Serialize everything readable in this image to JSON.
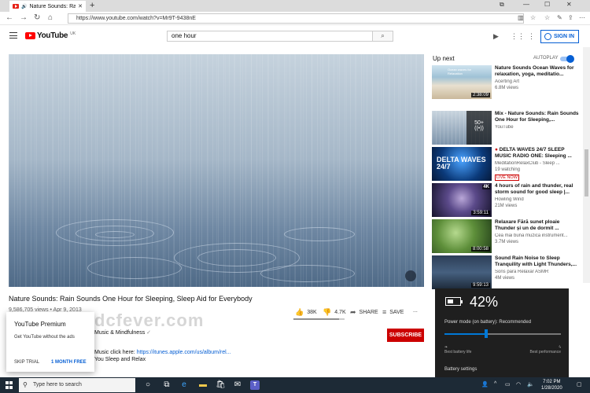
{
  "browser": {
    "tab_title": "Nature Sounds: Rai",
    "url": "https://www.youtube.com/watch?v=Mr9T-9438nE"
  },
  "youtube": {
    "logo_text": "YouTube",
    "region": "UK",
    "search_value": "one hour",
    "sign_in": "SIGN IN"
  },
  "video": {
    "title": "Nature Sounds: Rain Sounds One Hour for Sleeping, Sleep Aid for Everybody",
    "meta": "9,586,705 views • Apr 9, 2013",
    "likes": "38K",
    "dislikes": "4.7K",
    "like_ratio": 0.89,
    "share": "SHARE",
    "save": "SAVE",
    "more": "...",
    "channel": "Music & Mindfulness",
    "subscribe": "SUBSCRIBE",
    "desc_prefix": "Music click here: ",
    "desc_link": "https://itunes.apple.com/us/album/rel...",
    "desc_line2": "You Sleep and Relax"
  },
  "watermark": "dcfever.com",
  "premium": {
    "title": "YouTube Premium",
    "subtitle": "Get YouTube without the ads",
    "skip": "SKIP TRIAL",
    "free": "1 MONTH FREE"
  },
  "sidebar": {
    "up_next": "Up next",
    "autoplay": "AUTOPLAY",
    "items": [
      {
        "title": "Nature Sounds Ocean Waves for relaxation, yoga, meditatio...",
        "channel": "Acerting Art",
        "views": "6.8M views",
        "duration": "2:38:09",
        "thumb_text": "Ocean waves for Relaxation"
      },
      {
        "title": "Mix - Nature Sounds: Rain Sounds One Hour for Sleeping,...",
        "channel": "YouTube",
        "views": "",
        "duration": "",
        "mix_count": "50+"
      },
      {
        "title": "DELTA WAVES 24/7 SLEEP MUSIC RADIO ONE: Sleeping ...",
        "channel": "MeditationRelaxClub - Sleep ...",
        "views": "19 watching",
        "duration": "",
        "live": "LIVE NOW",
        "thumb_text": "DELTA WAVES 24/7"
      },
      {
        "title": "4 hours of rain and thunder, real storm sound for good sleep |...",
        "channel": "Howling Wind",
        "views": "21M views",
        "duration": "3:59:11",
        "thumb_text": "4K"
      },
      {
        "title": "Relaxare Fără sunet ploaie Thunder și un de dormit ...",
        "channel": "Cea mai bună muzică instrument...",
        "views": "3.7M views",
        "duration": "8:00:58"
      },
      {
        "title": "Sound Rain Noise to Sleep Tranquility with Light Thunders,...",
        "channel": "Sons para Relaxar ASMR",
        "views": "4M views",
        "duration": "9:59:13"
      }
    ]
  },
  "battery": {
    "percent": "42%",
    "power_mode": "Power mode (on battery): Recommended",
    "best_life": "Best battery life",
    "best_perf": "Best performance",
    "settings": "Battery settings",
    "slider_level": 0.36
  },
  "taskbar": {
    "search_placeholder": "Type here to search",
    "time": "7:02 PM",
    "date": "1/28/2020"
  },
  "icons": {
    "back": "arrow-left-icon",
    "forward": "arrow-right-icon",
    "refresh": "refresh-icon",
    "home": "home-icon"
  },
  "colors": {
    "youtube_red": "#ff0000",
    "link_blue": "#065fd4",
    "subscribe_red": "#cc0000",
    "flyout_bg": "#1f1f1f",
    "taskbar_bg": "#1d2a36"
  }
}
